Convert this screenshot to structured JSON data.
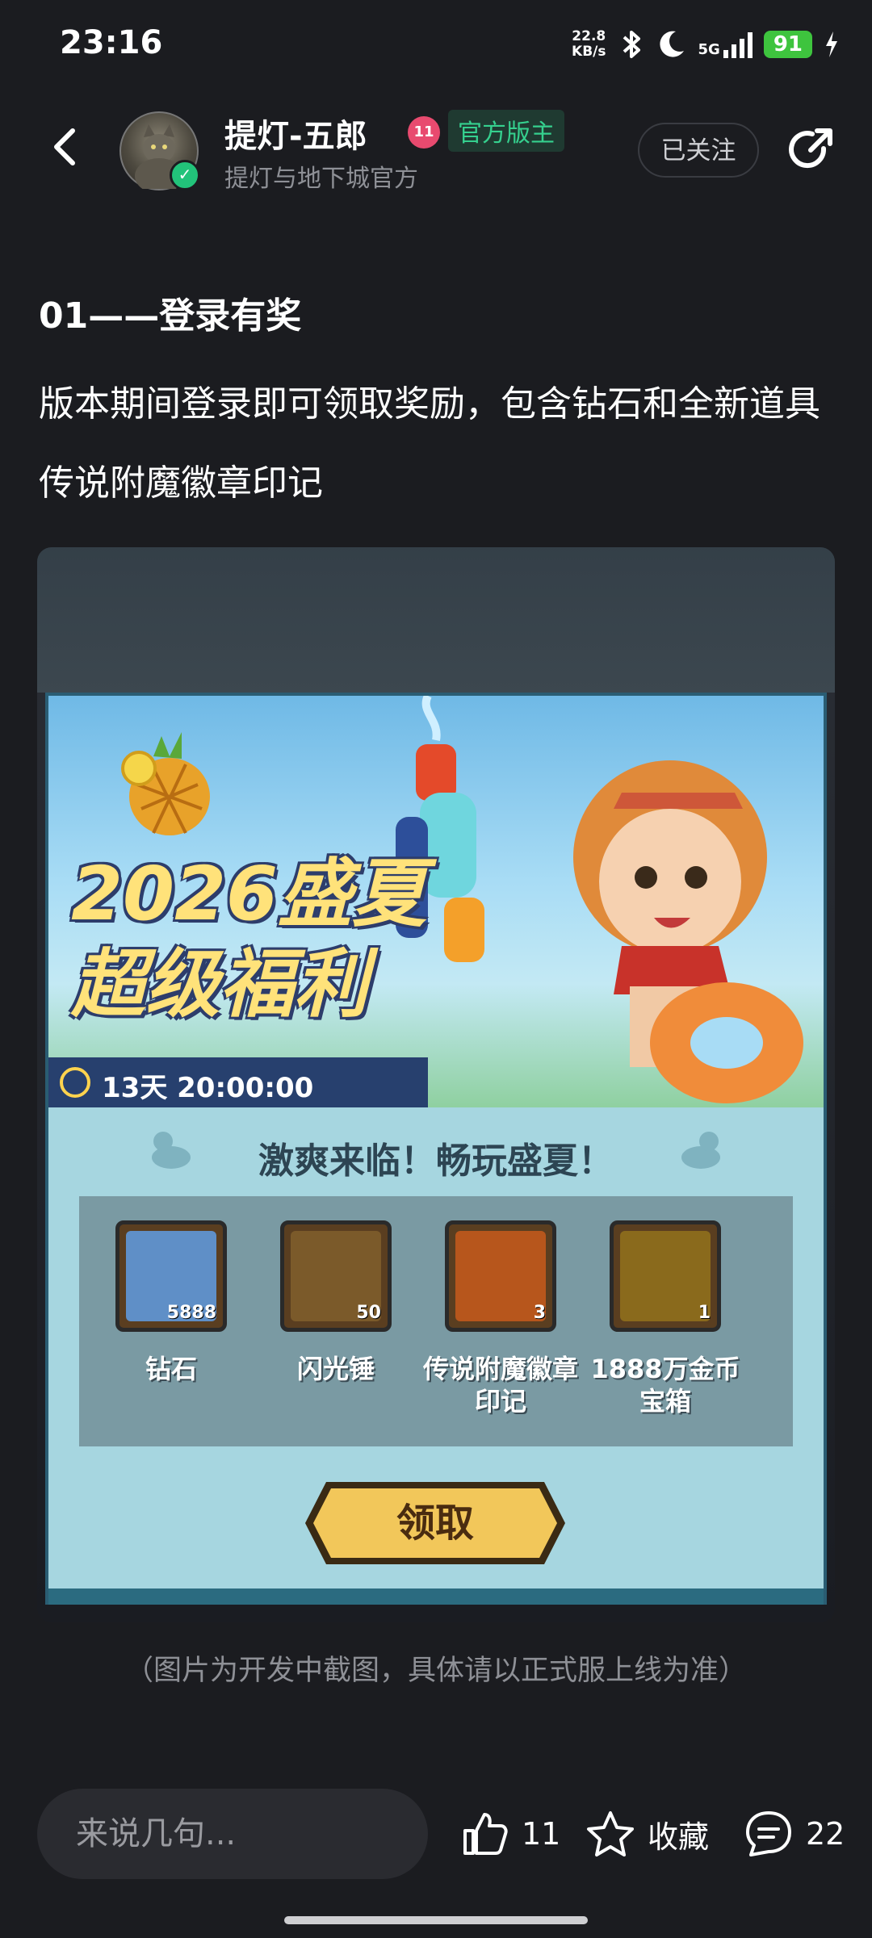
{
  "status_bar": {
    "time": "23:16",
    "net_speed_value": "22.8",
    "net_speed_unit": "KB/s",
    "network": "5G",
    "battery": "91"
  },
  "header": {
    "username": "提灯-五郎",
    "level": "11",
    "badge": "官方版主",
    "subtitle": "提灯与地下城官方",
    "follow_label": "已关注"
  },
  "post": {
    "heading": "01——登录有奖",
    "paragraph": "版本期间登录即可领取奖励，包含钻石和全新道具传说附魔徽章印记",
    "caption": "（图片为开发中截图，具体请以正式服上线为准）"
  },
  "promo": {
    "title_line1": "2026盛夏",
    "title_line2": "超级福利",
    "timer": "13天 20:00:00",
    "subtitle": "激爽来临！畅玩盛夏！",
    "rewards": [
      {
        "name": "钻石",
        "qty": "5888",
        "color": "#5f8fc7"
      },
      {
        "name": "闪光锤",
        "qty": "50",
        "color": "#7b5a2a"
      },
      {
        "name": "传说附魔徽章印记",
        "qty": "3",
        "color": "#b7561c"
      },
      {
        "name": "1888万金币宝箱",
        "qty": "1",
        "color": "#8a6a1c"
      }
    ],
    "claim_label": "领取"
  },
  "bottom_bar": {
    "input_placeholder": "来说几句...",
    "like_count": "11",
    "collect_label": "收藏",
    "comment_count": "22"
  }
}
